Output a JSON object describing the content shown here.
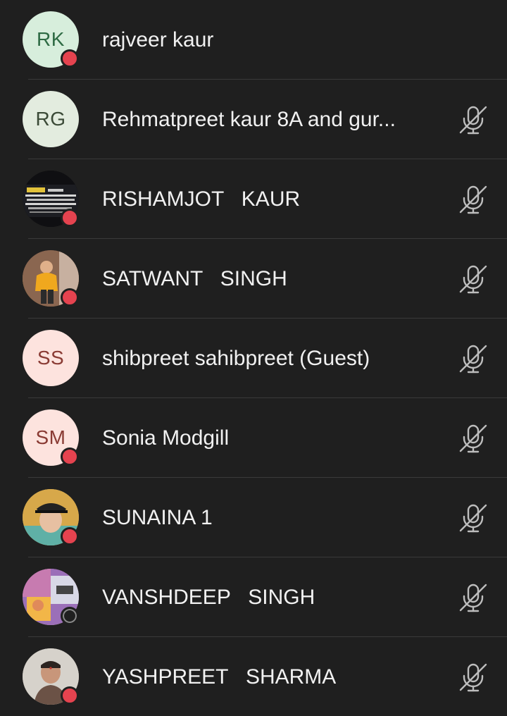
{
  "participants": [
    {
      "name": "rajveer kaur",
      "initials": "RK",
      "avatar_bg": "#d7eedc",
      "initials_color": "#2e6b44",
      "status": "red",
      "muted": false
    },
    {
      "name": "Rehmatpreet kaur 8A and gur...",
      "initials": "RG",
      "avatar_bg": "#e3ecdf",
      "initials_color": "#3b4a37",
      "status": "none",
      "muted": true
    },
    {
      "name": "RISHAMJOT   KAUR",
      "initials": "",
      "avatar_type": "photo-signboard",
      "status": "red",
      "muted": true
    },
    {
      "name": "SATWANT   SINGH",
      "initials": "",
      "avatar_type": "photo-girl",
      "status": "red",
      "muted": true
    },
    {
      "name": "shibpreet sahibpreet (Guest)",
      "initials": "SS",
      "avatar_bg": "#fde3de",
      "initials_color": "#8a3b34",
      "status": "none",
      "muted": true
    },
    {
      "name": "Sonia Modgill",
      "initials": "SM",
      "avatar_bg": "#fde3de",
      "initials_color": "#8a3b34",
      "status": "red",
      "muted": true
    },
    {
      "name": "SUNAINA 1",
      "initials": "",
      "avatar_type": "photo-cap",
      "status": "red",
      "muted": true
    },
    {
      "name": "VANSHDEEP   SINGH",
      "initials": "",
      "avatar_type": "photo-collage",
      "status": "grey",
      "muted": true
    },
    {
      "name": "YASHPREET   SHARMA",
      "initials": "",
      "avatar_type": "photo-boy",
      "status": "red",
      "muted": true
    }
  ],
  "icons": {
    "mute": "microphone-off-icon"
  },
  "colors": {
    "background": "#1f1f1f",
    "text": "#f1f1f1",
    "divider": "#3a3a3a",
    "status_red": "#e5434f",
    "icon": "#bdbdbd"
  }
}
